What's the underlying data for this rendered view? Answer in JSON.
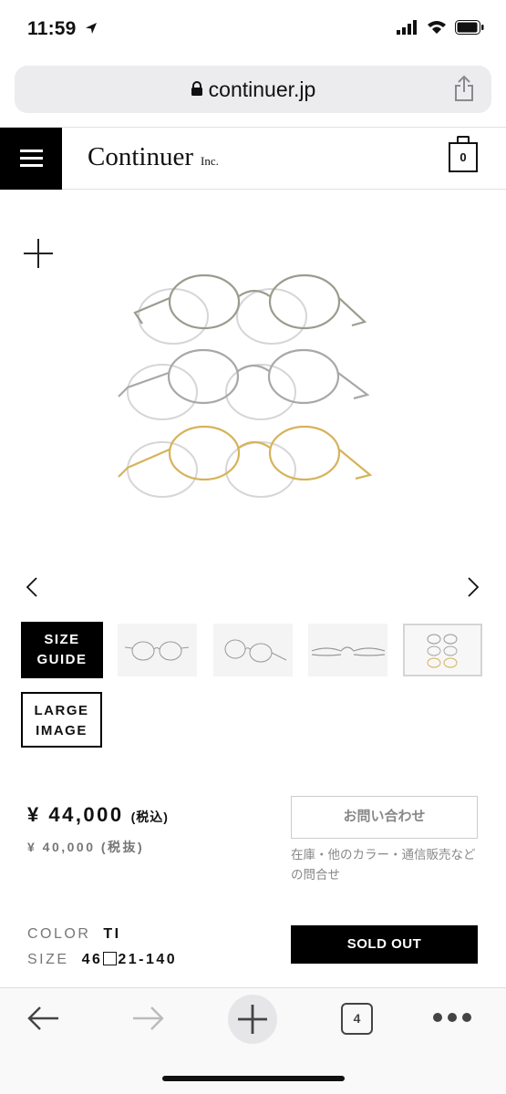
{
  "status_bar": {
    "time": "11:59"
  },
  "browser": {
    "url": "continuer.jp",
    "tab_count": "4"
  },
  "site": {
    "logo": "Continuer",
    "logo_suffix": "Inc.",
    "cart_count": "0"
  },
  "product": {
    "thumbnails": [
      "thumb-1",
      "thumb-2",
      "thumb-3",
      "thumb-4"
    ],
    "size_guide_line1": "SIZE",
    "size_guide_line2": "GUIDE",
    "large_image_line1": "LARGE",
    "large_image_line2": "IMAGE",
    "price_incl": "¥ 44,000",
    "price_incl_label": "(税込)",
    "price_excl": "¥ 40,000 (税抜)",
    "inquiry_label": "お問い合わせ",
    "inquiry_note": "在庫・他のカラー・通信販売などの問合せ",
    "color_label": "COLOR",
    "color_value": "TI",
    "size_label": "SIZE",
    "size_value_a": "46",
    "size_value_b": "21-140",
    "sold_out_label": "SOLD OUT"
  },
  "colors": {
    "brand_black": "#000000",
    "frame_gold": "#d6b35a",
    "frame_silver": "#9a9a9a"
  }
}
